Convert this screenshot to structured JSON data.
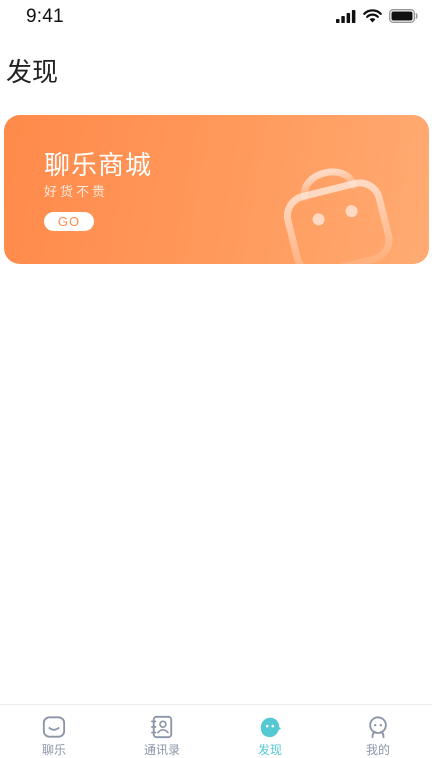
{
  "status_bar": {
    "time": "9:41",
    "icons": [
      "signal-icon",
      "wifi-icon",
      "battery-icon"
    ]
  },
  "page": {
    "title": "发现"
  },
  "mall_card": {
    "title": "聊乐商城",
    "subtitle": "好货不贵",
    "button_label": "GO",
    "icon": "shopping-bag-icon",
    "gradient_start": "#ff8a4a",
    "gradient_end": "#ffab73"
  },
  "tab_bar": {
    "active_color": "#55c9d3",
    "inactive_color": "#8c95a8",
    "items": [
      {
        "label": "聊乐",
        "icon": "chat-icon",
        "active": false
      },
      {
        "label": "通讯录",
        "icon": "contacts-icon",
        "active": false
      },
      {
        "label": "发现",
        "icon": "discover-icon",
        "active": true
      },
      {
        "label": "我的",
        "icon": "profile-icon",
        "active": false
      }
    ]
  }
}
